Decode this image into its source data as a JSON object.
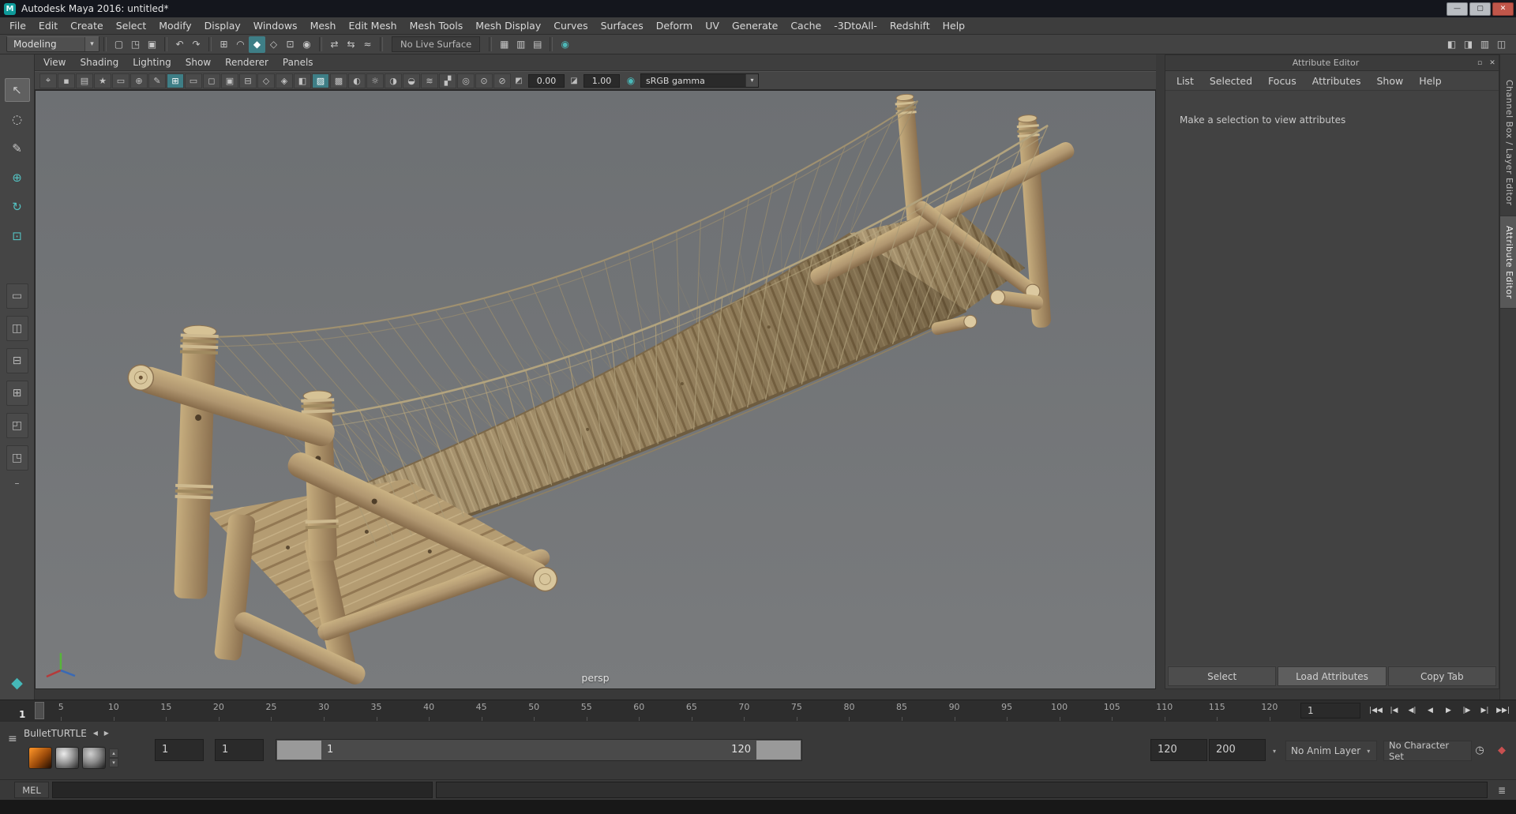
{
  "titlebar": {
    "title": "Autodesk Maya 2016: untitled*",
    "logo_glyph": "M",
    "minimize_glyph": "—",
    "maximize_glyph": "▢",
    "close_glyph": "✕"
  },
  "menubar": {
    "items": [
      {
        "name": "menu-file",
        "label": "File"
      },
      {
        "name": "menu-edit",
        "label": "Edit"
      },
      {
        "name": "menu-create",
        "label": "Create"
      },
      {
        "name": "menu-select",
        "label": "Select"
      },
      {
        "name": "menu-modify",
        "label": "Modify"
      },
      {
        "name": "menu-display",
        "label": "Display"
      },
      {
        "name": "menu-windows",
        "label": "Windows"
      },
      {
        "name": "menu-mesh",
        "label": "Mesh"
      },
      {
        "name": "menu-edit-mesh",
        "label": "Edit Mesh"
      },
      {
        "name": "menu-mesh-tools",
        "label": "Mesh Tools"
      },
      {
        "name": "menu-mesh-display",
        "label": "Mesh Display"
      },
      {
        "name": "menu-curves",
        "label": "Curves"
      },
      {
        "name": "menu-surfaces",
        "label": "Surfaces"
      },
      {
        "name": "menu-deform",
        "label": "Deform"
      },
      {
        "name": "menu-uv",
        "label": "UV"
      },
      {
        "name": "menu-generate",
        "label": "Generate"
      },
      {
        "name": "menu-cache",
        "label": "Cache"
      },
      {
        "name": "menu-3dtoall",
        "label": "-3DtoAll-"
      },
      {
        "name": "menu-redshift",
        "label": "Redshift"
      },
      {
        "name": "menu-help",
        "label": "Help"
      }
    ]
  },
  "statusline": {
    "mode_selector": {
      "label": "Modeling",
      "caret": "▾"
    },
    "live_surface_label": "No Live Surface",
    "icons_left": [
      {
        "sep": true
      },
      {
        "name": "new-scene-icon",
        "glyph": "▢"
      },
      {
        "name": "open-scene-icon",
        "glyph": "◳"
      },
      {
        "name": "save-scene-icon",
        "glyph": "▣"
      },
      {
        "sep": true
      },
      {
        "name": "undo-icon",
        "glyph": "↶"
      },
      {
        "name": "redo-icon",
        "glyph": "↷"
      },
      {
        "sep": true
      },
      {
        "name": "snap-to-grid-icon",
        "glyph": "⊞"
      },
      {
        "name": "snap-to-curve-icon",
        "glyph": "◠"
      },
      {
        "name": "snap-to-point-icon",
        "glyph": "◆",
        "active": true
      },
      {
        "name": "snap-to-projected-center-icon",
        "glyph": "◇"
      },
      {
        "name": "snap-to-view-plane-icon",
        "glyph": "⊡"
      },
      {
        "name": "make-live-icon",
        "glyph": "◉"
      },
      {
        "sep": true
      },
      {
        "name": "input-connections-icon",
        "glyph": "⇄"
      },
      {
        "name": "output-connections-icon",
        "glyph": "⇆"
      },
      {
        "name": "construction-history-icon",
        "glyph": "≈"
      },
      {
        "sep": true
      }
    ],
    "icons_mid": [
      {
        "sep": true
      },
      {
        "name": "render-current-frame-icon",
        "glyph": "▦"
      },
      {
        "name": "ipr-render-icon",
        "glyph": "▥"
      },
      {
        "name": "render-settings-icon",
        "glyph": "▤"
      },
      {
        "sep": true
      },
      {
        "name": "paint-effects-icon",
        "glyph": "◉",
        "color": "#4db6b6"
      }
    ],
    "icons_right": [
      {
        "name": "toggle-modeling-toolkit-icon",
        "glyph": "◧"
      },
      {
        "name": "toggle-attribute-editor-icon",
        "glyph": "◨"
      },
      {
        "name": "toggle-tool-settings-icon",
        "glyph": "▥"
      },
      {
        "name": "toggle-channel-box-icon",
        "glyph": "◫"
      }
    ]
  },
  "toolbox": {
    "tools": [
      {
        "name": "select-tool",
        "glyph": "↖",
        "active": true
      },
      {
        "name": "lasso-tool",
        "glyph": "◌"
      },
      {
        "name": "paint-select-tool",
        "glyph": "✎"
      },
      {
        "name": "move-tool",
        "glyph": "⊕",
        "color": "#54c1c1"
      },
      {
        "name": "rotate-tool",
        "glyph": "↻",
        "color": "#54c1c1"
      },
      {
        "name": "scale-tool",
        "glyph": "⊡",
        "color": "#54c1c1"
      }
    ],
    "layouts": [
      {
        "name": "layout-single-pane-button",
        "glyph": "▭"
      },
      {
        "name": "layout-persp-outliner-button",
        "glyph": "◫"
      },
      {
        "name": "layout-two-stacked-button",
        "glyph": "⊟"
      },
      {
        "name": "layout-four-pane-button",
        "glyph": "⊞"
      },
      {
        "name": "layout-three-split-button",
        "glyph": "◰"
      },
      {
        "name": "layout-persp-graph-button",
        "glyph": "◳"
      }
    ],
    "more_glyph": "–",
    "bottom_icon_glyph": "◆"
  },
  "panel": {
    "menus": [
      {
        "name": "panel-menu-view",
        "label": "View"
      },
      {
        "name": "panel-menu-shading",
        "label": "Shading"
      },
      {
        "name": "panel-menu-lighting",
        "label": "Lighting"
      },
      {
        "name": "panel-menu-show",
        "label": "Show"
      },
      {
        "name": "panel-menu-renderer",
        "label": "Renderer"
      },
      {
        "name": "panel-menu-panels",
        "label": "Panels"
      }
    ],
    "toolbar_icons": [
      {
        "name": "select-camera-icon",
        "glyph": "⌖"
      },
      {
        "name": "lock-camera-icon",
        "glyph": "▪"
      },
      {
        "name": "camera-attributes-icon",
        "glyph": "▤"
      },
      {
        "name": "bookmark-icon",
        "glyph": "★"
      },
      {
        "name": "image-plane-icon",
        "glyph": "▭"
      },
      {
        "name": "two-d-pan-zoom-icon",
        "glyph": "⊕"
      },
      {
        "name": "grease-pencil-icon",
        "glyph": "✎"
      },
      {
        "name": "grid-toggle-icon",
        "glyph": "⊞",
        "active": true
      },
      {
        "name": "film-gate-icon",
        "glyph": "▭"
      },
      {
        "name": "resolution-gate-icon",
        "glyph": "◻"
      },
      {
        "name": "gate-mask-icon",
        "glyph": "▣"
      },
      {
        "name": "field-chart-icon",
        "glyph": "⊟"
      },
      {
        "name": "safe-action-icon",
        "glyph": "◇"
      },
      {
        "name": "safe-title-icon",
        "glyph": "◈"
      },
      {
        "name": "fill-mode-icon",
        "glyph": "◧"
      },
      {
        "name": "textured-mode-icon",
        "glyph": "▨",
        "active": true
      },
      {
        "name": "wireframe-on-shaded-icon",
        "glyph": "▩"
      },
      {
        "name": "default-material-icon",
        "glyph": "◐"
      },
      {
        "name": "use-all-lights-icon",
        "glyph": "☼"
      },
      {
        "name": "shadows-icon",
        "glyph": "◑"
      },
      {
        "name": "screen-space-ao-icon",
        "glyph": "◒"
      },
      {
        "name": "motion-blur-icon",
        "glyph": "≋"
      },
      {
        "name": "anti-aliasing-icon",
        "glyph": "▞"
      },
      {
        "name": "depth-of-field-icon",
        "glyph": "◎"
      },
      {
        "name": "isolate-select-icon",
        "glyph": "⊙"
      },
      {
        "name": "x-ray-icon",
        "glyph": "⊘"
      }
    ],
    "exposure_icon": "◩",
    "exposure_value": "0.00",
    "gamma_icon": "◪",
    "gamma_value": "1.00",
    "colormgmt_icon": "◉",
    "colorspace": {
      "label": "sRGB gamma",
      "caret": "▾"
    }
  },
  "viewport": {
    "camera_label": "persp"
  },
  "attribute_editor": {
    "title": "Attribute Editor",
    "float_icon": "▫",
    "close_icon": "✕",
    "menus": [
      {
        "name": "ae-menu-list",
        "label": "List"
      },
      {
        "name": "ae-menu-selected",
        "label": "Selected"
      },
      {
        "name": "ae-menu-focus",
        "label": "Focus"
      },
      {
        "name": "ae-menu-attributes",
        "label": "Attributes"
      },
      {
        "name": "ae-menu-show",
        "label": "Show"
      },
      {
        "name": "ae-menu-help",
        "label": "Help"
      }
    ],
    "message": "Make a selection to view attributes",
    "buttons": [
      {
        "name": "select-button",
        "label": "Select"
      },
      {
        "name": "load-attributes-button",
        "label": "Load Attributes",
        "active": true
      },
      {
        "name": "copy-tab-button",
        "label": "Copy Tab"
      }
    ]
  },
  "right_tabs": [
    {
      "name": "tab-channel-box-layer-editor",
      "label": "Channel Box / Layer Editor"
    },
    {
      "name": "tab-attribute-editor",
      "label": "Attribute Editor",
      "active": true
    }
  ],
  "timeline": {
    "ticks": [
      "5",
      "10",
      "15",
      "20",
      "25",
      "30",
      "35",
      "40",
      "45",
      "50",
      "55",
      "60",
      "65",
      "70",
      "75",
      "80",
      "85",
      "90",
      "95",
      "100",
      "105",
      "110",
      "115",
      "120"
    ],
    "current_frame": "1",
    "frame_field": "1",
    "playback": [
      {
        "name": "go-to-start-button",
        "glyph": "|◀◀"
      },
      {
        "name": "step-back-frame-button",
        "glyph": "|◀"
      },
      {
        "name": "step-back-key-button",
        "glyph": "◀|"
      },
      {
        "name": "play-backwards-button",
        "glyph": "◀"
      },
      {
        "name": "play-forwards-button",
        "glyph": "▶"
      },
      {
        "name": "step-forward-key-button",
        "glyph": "|▶"
      },
      {
        "name": "step-forward-frame-button",
        "glyph": "▶|"
      },
      {
        "name": "go-to-end-button",
        "glyph": "▶▶|"
      }
    ]
  },
  "range": {
    "shelf_menu_glyph": "≡",
    "shelf_tabs": [
      {
        "name": "shelf-tab-bullet",
        "label": "Bullet"
      },
      {
        "name": "shelf-tab-turtle",
        "label": "TURTLE",
        "active": true
      }
    ],
    "shelf_nav": [
      {
        "name": "shelf-prev-button",
        "glyph": "◀"
      },
      {
        "name": "shelf-next-button",
        "glyph": "▶"
      }
    ],
    "spinner_up": "▴",
    "spinner_down": "▾",
    "anim_start": "1",
    "playback_start": "1",
    "bar_start_label": "1",
    "bar_end_label": "120",
    "playback_end": "120",
    "anim_end": "200",
    "dropdown_caret": "▾",
    "anim_layer": "No Anim Layer",
    "character_set": "No Character Set",
    "pref_icons": [
      {
        "name": "animation-preferences-icon",
        "glyph": "◷"
      },
      {
        "name": "auto-keyframe-icon",
        "glyph": "◆",
        "color": "#c85050"
      }
    ]
  },
  "command_line": {
    "label": "MEL",
    "script_editor_icon": "≣"
  }
}
